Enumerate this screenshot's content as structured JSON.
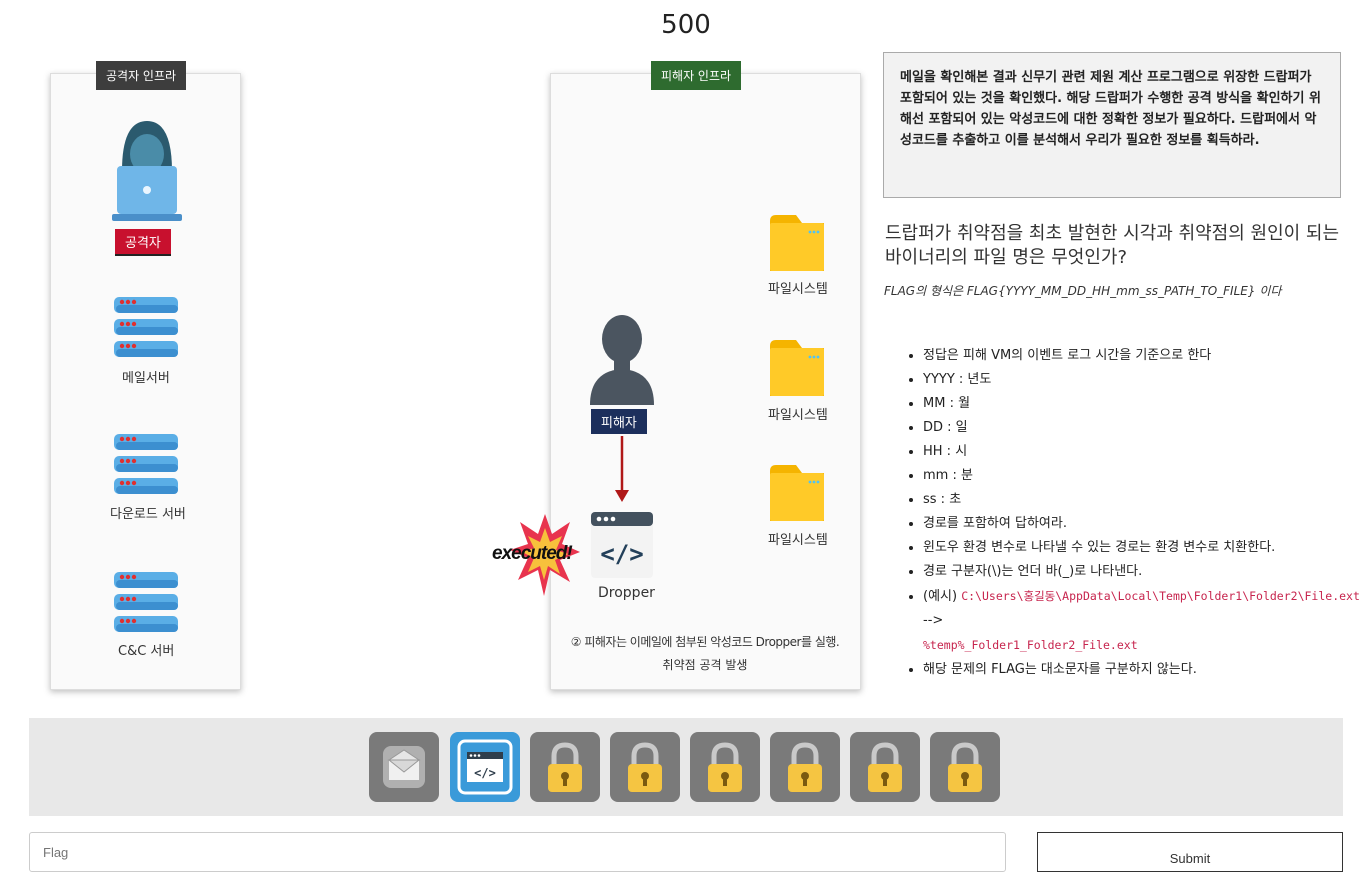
{
  "score": "500",
  "diagram": {
    "attacker_infra_label": "공격자 인프라",
    "victim_infra_label": "피해자 인프라",
    "attacker_label": "공격자",
    "mail_server_label": "메일서버",
    "download_server_label": "다운로드 서버",
    "cc_server_label": "C&C 서버",
    "filesystem_labels": [
      "파일시스템",
      "파일시스템",
      "파일시스템"
    ],
    "victim_label": "피해자",
    "executed_label": "executed!",
    "dropper_label": "Dropper",
    "caption_line1": "② 피해자는 이메일에 첨부된 악성코드 Dropper를 실행.",
    "caption_line2": "취약점 공격 발생"
  },
  "description": "메일을 확인해본 결과 신무기 관련 제원 계산 프로그램으로 위장한 드랍퍼가 포함되어 있는 것을 확인했다. 해당 드랍퍼가 수행한 공격 방식을 확인하기 위해선 포함되어 있는 악성코드에 대한 정확한 정보가 필요하다. 드랍퍼에서 악성코드를 추출하고 이를 분석해서 우리가 필요한 정보를 획득하라.",
  "question": "드랍퍼가 취약점을 최초 발현한 시각과 취약점의 원인이 되는 바이너리의 파일 명은 무엇인가?",
  "flag_format": "FLAG의 형식은 FLAG{YYYY_MM_DD_HH_mm_ss_PATH_TO_FILE} 이다",
  "rules": [
    "정답은 피해 VM의 이벤트 로그 시간을 기준으로 한다",
    "YYYY : 년도",
    "MM : 월",
    "DD : 일",
    "HH : 시",
    "mm : 분",
    "ss : 초",
    "경로를 포함하여 답하여라.",
    "윈도우 환경 변수로 나타낼 수 있는 경로는 환경 변수로 치환한다.",
    "경로 구분자(\\)는 언더 바(_)로 나타낸다."
  ],
  "example": {
    "prefix": "(예시) ",
    "path_original": "C:\\Users\\홍길동\\AppData\\Local\\Temp\\Folder1\\Folder2\\File.ext",
    "arrow": " -->",
    "path_converted": "%temp%_Folder1_Folder2_File.ext"
  },
  "last_rule": "해당 문제의 FLAG는 대소문자를 구분하지 않는다.",
  "stages": [
    {
      "icon": "mail-icon",
      "state": "done"
    },
    {
      "icon": "code-window-icon",
      "state": "active"
    },
    {
      "icon": "lock-icon",
      "state": "locked"
    },
    {
      "icon": "lock-icon",
      "state": "locked"
    },
    {
      "icon": "lock-icon",
      "state": "locked"
    },
    {
      "icon": "lock-icon",
      "state": "locked"
    },
    {
      "icon": "lock-icon",
      "state": "locked"
    },
    {
      "icon": "lock-icon",
      "state": "locked"
    }
  ],
  "flag_input": {
    "placeholder": "Flag",
    "value": ""
  },
  "submit_label": "Submit",
  "colors": {
    "accent": "#3a9ad9",
    "stage_bar": "#e8e8e8",
    "attacker_red": "#c8102e",
    "victim_navy": "#1c2f5c"
  }
}
